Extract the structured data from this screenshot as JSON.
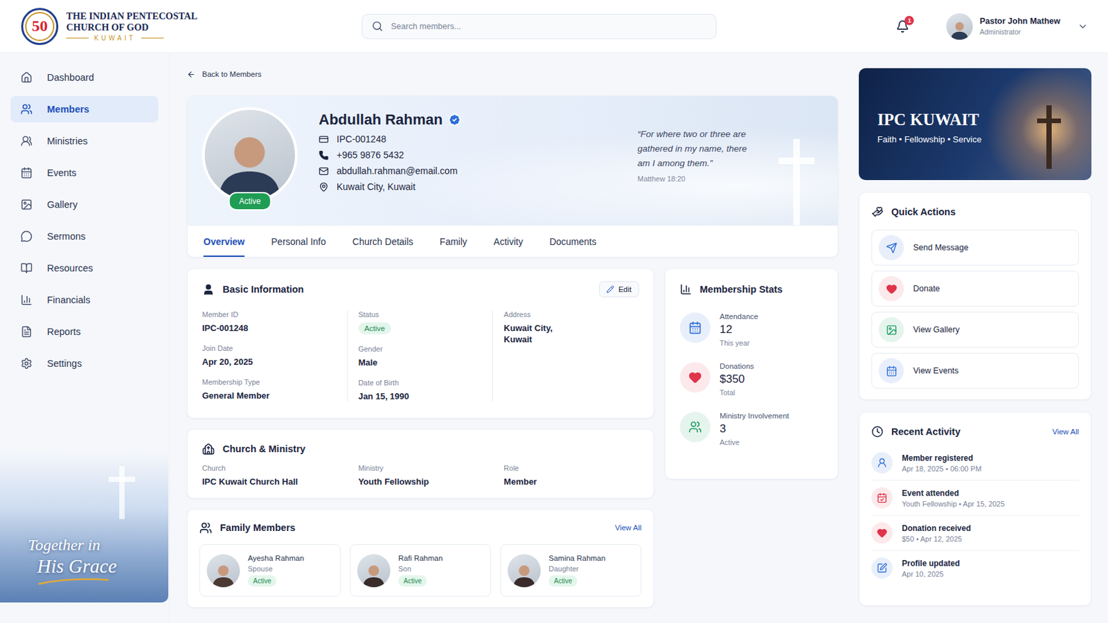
{
  "header": {
    "logo": {
      "badge": "50",
      "line1": "THE INDIAN PENTECOSTAL",
      "line2": "CHURCH OF GOD",
      "line3": "KUWAIT"
    },
    "search": {
      "placeholder": "Search members..."
    },
    "notifications": "1",
    "user": {
      "name": "Pastor John Mathew",
      "role": "Administrator"
    }
  },
  "sidebar": {
    "items": [
      {
        "label": "Dashboard",
        "selected": false
      },
      {
        "label": "Members",
        "selected": true
      },
      {
        "label": "Ministries",
        "selected": false
      },
      {
        "label": "Events",
        "selected": false
      },
      {
        "label": "Gallery",
        "selected": false
      },
      {
        "label": "Sermons",
        "selected": false
      },
      {
        "label": "Resources",
        "selected": false
      },
      {
        "label": "Financials",
        "selected": false
      },
      {
        "label": "Reports",
        "selected": false
      },
      {
        "label": "Settings",
        "selected": false
      }
    ],
    "banner": {
      "line1": "Together in",
      "line2": "His Grace"
    }
  },
  "back": "Back to Members",
  "profile": {
    "name": "Abdullah Rahman",
    "verified": true,
    "status": "Active",
    "memberId": "IPC-001248",
    "phone": "+965 9876 5432",
    "email": "abdullah.rahman@email.com",
    "location": "Kuwait City, Kuwait",
    "quote": "“For where two or three are gathered in my name, there am I among them.”",
    "quoteRef": "Matthew 18:20"
  },
  "tabs": [
    {
      "label": "Overview",
      "selected": true
    },
    {
      "label": "Personal Info",
      "selected": false
    },
    {
      "label": "Church Details",
      "selected": false
    },
    {
      "label": "Family",
      "selected": false
    },
    {
      "label": "Activity",
      "selected": false
    },
    {
      "label": "Documents",
      "selected": false
    }
  ],
  "basicInfo": {
    "title": "Basic Information",
    "edit": "Edit",
    "columns": [
      [
        {
          "label": "Member ID",
          "value": "IPC-001248",
          "kind": "text"
        },
        {
          "label": "Join Date",
          "value": "Apr 20, 2025",
          "kind": "text"
        },
        {
          "label": "Membership Type",
          "value": "General Member",
          "kind": "text"
        }
      ],
      [
        {
          "label": "Status",
          "value": "Active",
          "kind": "badge"
        },
        {
          "label": "Gender",
          "value": "Male",
          "kind": "text"
        },
        {
          "label": "Date of Birth",
          "value": "Jan 15, 1990",
          "kind": "text"
        }
      ],
      [
        {
          "label": "Address",
          "value": "Kuwait City, Kuwait",
          "kind": "text"
        }
      ]
    ]
  },
  "churchMinistry": {
    "title": "Church & Ministry",
    "fields": [
      {
        "label": "Church",
        "value": "IPC Kuwait Church Hall"
      },
      {
        "label": "Ministry",
        "value": "Youth Fellowship"
      },
      {
        "label": "Role",
        "value": "Member"
      }
    ]
  },
  "family": {
    "title": "Family Members",
    "viewAll": "View All",
    "members": [
      {
        "name": "Ayesha Rahman",
        "relation": "Spouse",
        "status": "Active"
      },
      {
        "name": "Rafi Rahman",
        "relation": "Son",
        "status": "Active"
      },
      {
        "name": "Samina Rahman",
        "relation": "Daughter",
        "status": "Active"
      }
    ]
  },
  "stats": {
    "title": "Membership Stats",
    "items": [
      {
        "label": "Attendance",
        "value": "12",
        "sub": "This year",
        "color": "#2f6fd6"
      },
      {
        "label": "Donations",
        "value": "$350",
        "sub": "Total",
        "color": "#e0344b"
      },
      {
        "label": "Ministry Involvement",
        "value": "3",
        "sub": "Active",
        "color": "#1f9d62"
      }
    ]
  },
  "banner": {
    "title": "IPC KUWAIT",
    "tagline": "Faith • Fellowship • Service"
  },
  "quickActions": {
    "title": "Quick Actions",
    "items": [
      {
        "label": "Send Message",
        "color": "#2f6fd6"
      },
      {
        "label": "Donate",
        "color": "#e0344b"
      },
      {
        "label": "View Gallery",
        "color": "#1f9d62"
      },
      {
        "label": "View Events",
        "color": "#2f6fd6"
      }
    ]
  },
  "recentActivity": {
    "title": "Recent Activity",
    "viewAll": "View All",
    "items": [
      {
        "title": "Member registered",
        "detail": "Apr 18, 2025 • 06:00 PM",
        "color": "#2f6fd6"
      },
      {
        "title": "Event attended",
        "detail": "Youth Fellowship • Apr 15, 2025",
        "color": "#e0344b"
      },
      {
        "title": "Donation received",
        "detail": "$50 • Apr 12, 2025",
        "color": "#e0344b"
      },
      {
        "title": "Profile updated",
        "detail": "Apr 10, 2025",
        "color": "#2f6fd6"
      }
    ]
  }
}
